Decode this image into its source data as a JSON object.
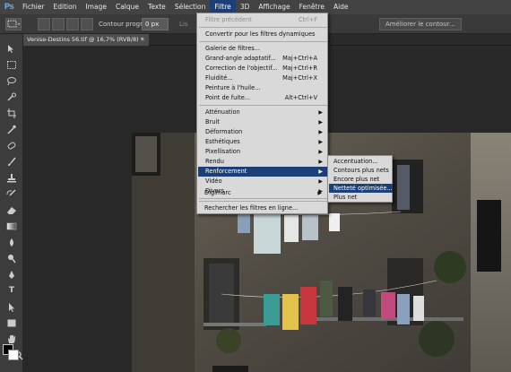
{
  "app": {
    "logo": "Ps"
  },
  "menubar": {
    "items": [
      "Fichier",
      "Edition",
      "Image",
      "Calque",
      "Texte",
      "Sélection",
      "Filtre",
      "3D",
      "Affichage",
      "Fenêtre",
      "Aide"
    ],
    "active_index": 6
  },
  "options": {
    "feather_label": "Contour progr. :",
    "feather_value": "0 px",
    "antialias_label": "Lis",
    "refine_button": "Améliorer le contour..."
  },
  "document": {
    "tab_title": "Venise-Destins 56.tif @ 16,7% (RVB/8) *",
    "close_glyph": "×"
  },
  "filter_menu": {
    "items": [
      {
        "label": "Filtre précédent",
        "shortcut": "Ctrl+F",
        "disabled": true
      },
      {
        "label": "Convertir pour les filtres dynamiques"
      },
      {
        "label": "Galerie de filtres..."
      },
      {
        "label": "Grand-angle adaptatif...",
        "shortcut": "Maj+Ctrl+A"
      },
      {
        "label": "Correction de l'objectif...",
        "shortcut": "Maj+Ctrl+R"
      },
      {
        "label": "Fluidité...",
        "shortcut": "Maj+Ctrl+X"
      },
      {
        "label": "Peinture à l'huile..."
      },
      {
        "label": "Point de fuite...",
        "shortcut": "Alt+Ctrl+V"
      },
      {
        "label": "Atténuation",
        "submenu": true
      },
      {
        "label": "Bruit",
        "submenu": true
      },
      {
        "label": "Déformation",
        "submenu": true
      },
      {
        "label": "Esthétiques",
        "submenu": true
      },
      {
        "label": "Pixellisation",
        "submenu": true
      },
      {
        "label": "Rendu",
        "submenu": true
      },
      {
        "label": "Renforcement",
        "submenu": true,
        "highlighted": true
      },
      {
        "label": "Vidéo",
        "submenu": true
      },
      {
        "label": "Divers",
        "submenu": true
      },
      {
        "label": "Digimarc",
        "submenu": true
      },
      {
        "label": "Rechercher les filtres en ligne..."
      }
    ]
  },
  "submenu": {
    "items": [
      {
        "label": "Accentuation..."
      },
      {
        "label": "Contours plus nets"
      },
      {
        "label": "Encore plus net"
      },
      {
        "label": "Netteté optimisée...",
        "highlighted": true
      },
      {
        "label": "Plus net"
      }
    ]
  },
  "colors": {
    "menu_highlight": "#1c3f78",
    "menu_bg": "#d9d9d9",
    "ui_dark": "#2b2b2b",
    "foreground_swatch": "#000000",
    "background_swatch": "#ffffff"
  },
  "toolbar": {
    "tools": [
      "move",
      "marquee",
      "lasso",
      "quick-select",
      "crop",
      "eyedropper",
      "spot-heal",
      "brush",
      "clone-stamp",
      "history-brush",
      "eraser",
      "gradient",
      "blur",
      "dodge",
      "pen",
      "type",
      "path-select",
      "shape",
      "hand",
      "zoom"
    ]
  }
}
